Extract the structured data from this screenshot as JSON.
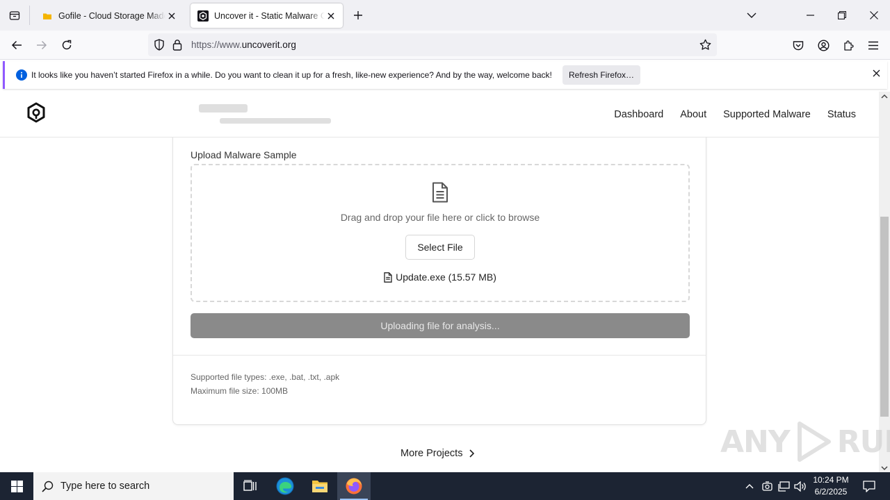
{
  "browser": {
    "tabs": [
      {
        "title": "Gofile - Cloud Storage Made Simple",
        "favicon": "folder-icon",
        "active": false
      },
      {
        "title": "Uncover it - Static Malware Conversion",
        "favicon": "uncoverit-logo-icon",
        "active": true
      }
    ],
    "url_scheme": "https://www.",
    "url_host": "uncoverit.org",
    "notification": {
      "message": "It looks like you haven’t started Firefox in a while. Do you want to clean it up for a fresh, like-new experience? And by the way, welcome back!",
      "button": "Refresh Firefox…"
    }
  },
  "site": {
    "nav": [
      "Dashboard",
      "About",
      "Supported Malware",
      "Status"
    ],
    "upload": {
      "section_label": "Upload Malware Sample",
      "hint": "Drag and drop your file here or click to browse",
      "select_button": "Select File",
      "file_name": "Update.exe (15.57 MB)",
      "progress_button": "Uploading file for analysis..."
    },
    "notes": {
      "types": "Supported file types: .exe, .bat, .txt, .apk",
      "size": "Maximum file size: 100MB"
    },
    "more_projects": "More Projects"
  },
  "watermark": {
    "left": "ANY",
    "right": "RUN"
  },
  "taskbar": {
    "search_placeholder": "Type here to search",
    "time": "10:24 PM",
    "date": "6/2/2025"
  },
  "colors": {
    "accent": "#9059ff",
    "info_blue": "#0060df",
    "upload_button": "#8a8a8a",
    "taskbar": "#1c2433"
  }
}
